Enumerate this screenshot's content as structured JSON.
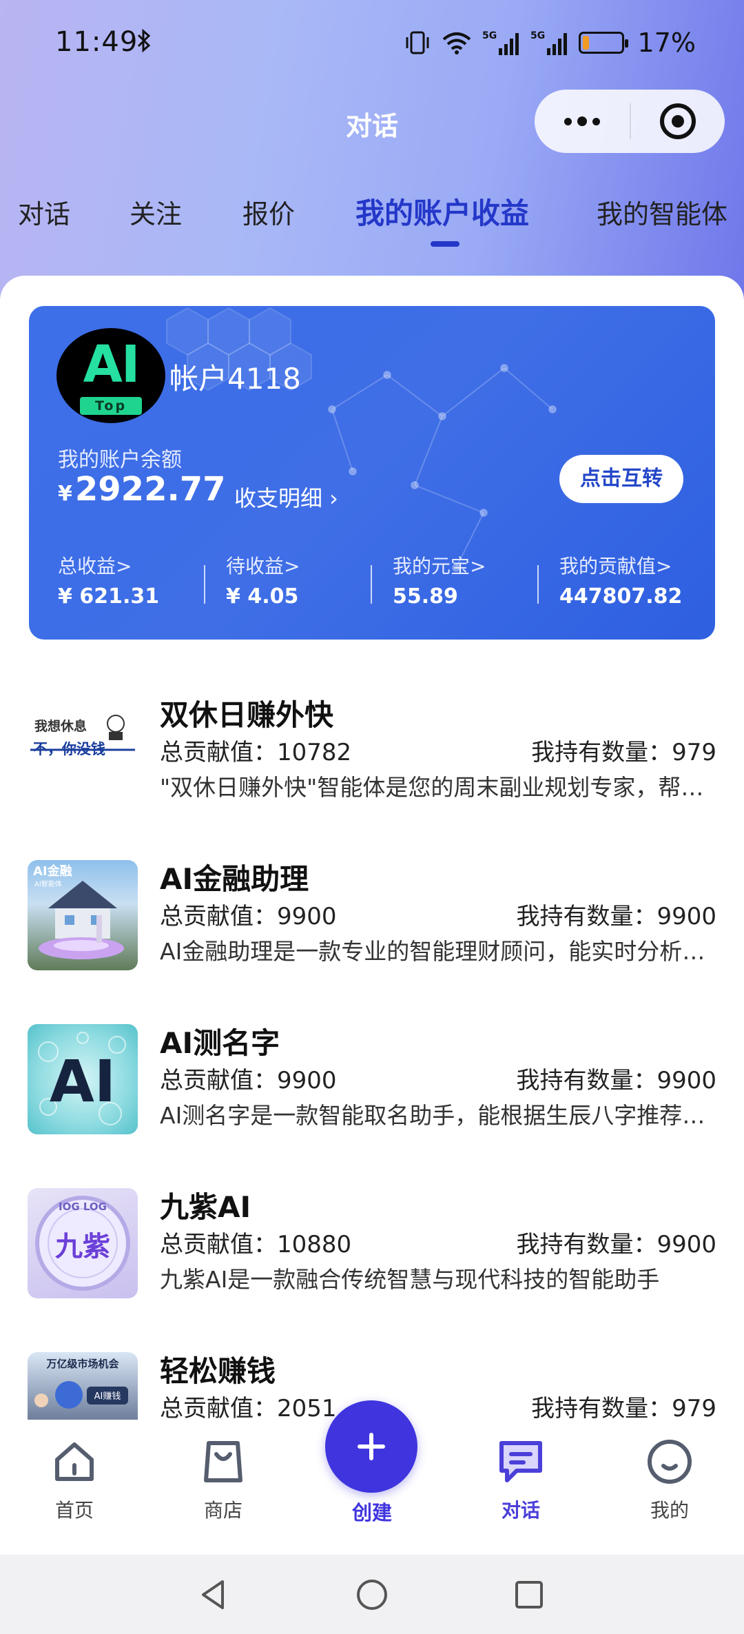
{
  "status_bar": {
    "time": "11:49",
    "battery": "17%",
    "battery_level": 0.17,
    "net1": "5G",
    "net2": "5G"
  },
  "header": {
    "title": "对话"
  },
  "tabs": [
    {
      "label": "对话"
    },
    {
      "label": "关注"
    },
    {
      "label": "报价"
    },
    {
      "label": "我的账户收益",
      "active": true
    },
    {
      "label": "我的智能体"
    }
  ],
  "account": {
    "avatar_text": "AI",
    "avatar_sub": "Top",
    "name": "帐户4118",
    "balance_label": "我的账户余额",
    "currency": "¥",
    "balance": "2922.77",
    "detail_link": "收支明细 ›",
    "swap_button": "点击互转",
    "stats": [
      {
        "label": "总收益>",
        "value": "¥ 621.31"
      },
      {
        "label": "待收益>",
        "value": "¥ 4.05"
      },
      {
        "label": "我的元宝>",
        "value": "55.89"
      },
      {
        "label": "我的贡献值>",
        "value": "447807.82"
      }
    ]
  },
  "agents": [
    {
      "name": "双休日赚外快",
      "total": "总贡献值：10782",
      "hold": "我持有数量：979",
      "desc": "\"双休日赚外快\"智能体是您的周末副业规划专家，帮您轻松赚取外快",
      "thumb_line1": "我想休息",
      "thumb_line2": "不，你没钱"
    },
    {
      "name": "AI金融助理",
      "total": "总贡献值：9900",
      "hold": "我持有数量：9900",
      "desc": "AI金融助理是一款专业的智能理财顾问，能实时分析市场行情",
      "thumb_line1": "AI金融",
      "thumb_line2": "AI智能体"
    },
    {
      "name": "AI测名字",
      "total": "总贡献值：9900",
      "hold": "我持有数量：9900",
      "desc": "AI测名字是一款智能取名助手，能根据生辰八字推荐好名字",
      "thumb_line1": "AI"
    },
    {
      "name": "九紫AI",
      "total": "总贡献值：10880",
      "hold": "我持有数量：9900",
      "desc": "九紫AI是一款融合传统智慧与现代科技的智能助手",
      "thumb_line1": "九紫",
      "thumb_line2": "IOG LOG"
    },
    {
      "name": "轻松赚钱",
      "total": "总贡献值：2051",
      "hold": "我持有数量：979",
      "desc": "",
      "thumb_line1": "万亿级市场机会",
      "thumb_line2": "AI赚钱"
    }
  ],
  "bottom_nav": [
    {
      "label": "首页",
      "icon": "home-icon"
    },
    {
      "label": "商店",
      "icon": "bag-icon"
    },
    {
      "label": "创建",
      "icon": "plus-icon"
    },
    {
      "label": "对话",
      "icon": "chat-icon",
      "active": true
    },
    {
      "label": "我的",
      "icon": "profile-icon"
    }
  ],
  "colors": {
    "accent": "#2437c9",
    "card": "#3d6fe8",
    "fab": "#3f34de"
  }
}
